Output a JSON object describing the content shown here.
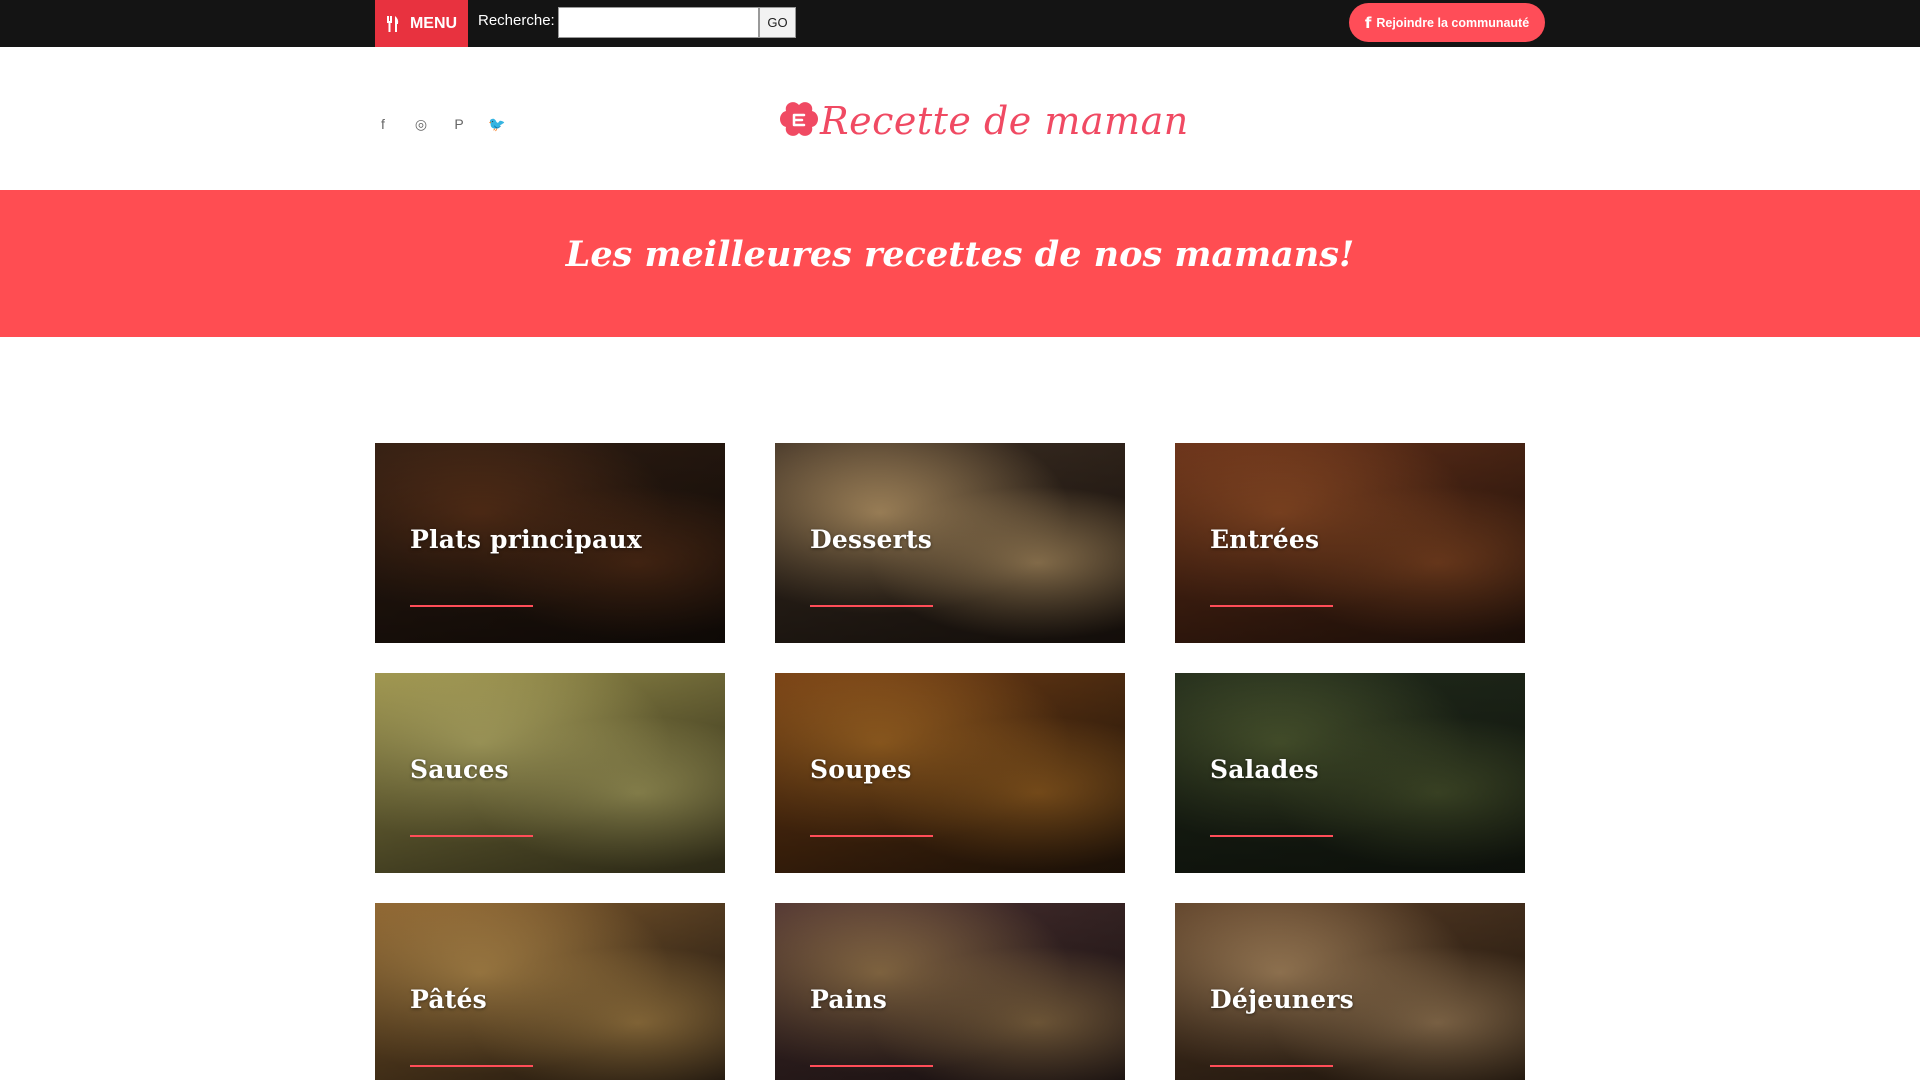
{
  "topbar": {
    "menu_label": "MENU",
    "search_label": "Recherche:",
    "search_value": "",
    "go_label": "GO",
    "community_label": "Rejoindre la communauté",
    "community_icon": "facebook-icon"
  },
  "header": {
    "socials": [
      {
        "icon": "facebook-icon",
        "glyph": "f"
      },
      {
        "icon": "instagram-icon",
        "glyph": "◎"
      },
      {
        "icon": "pinterest-icon",
        "glyph": "P"
      },
      {
        "icon": "twitter-icon",
        "glyph": "🐦"
      }
    ],
    "logo_text": "Recette de maman"
  },
  "banner": {
    "tagline": "Les meilleures recettes de nos mamans!"
  },
  "categories": [
    {
      "label": "Plats principaux",
      "colors": [
        "#3a2417",
        "#6b3a1d",
        "#1f140d"
      ]
    },
    {
      "label": "Desserts",
      "colors": [
        "#4a3a2c",
        "#d9b27a",
        "#2a1e16"
      ]
    },
    {
      "label": "Entrées",
      "colors": [
        "#7a3a1e",
        "#a95a2c",
        "#3b1f12"
      ]
    },
    {
      "label": "Sauces",
      "colors": [
        "#b8ad5a",
        "#d9cf7a",
        "#5e5830"
      ]
    },
    {
      "label": "Soupes",
      "colors": [
        "#8a4a18",
        "#c07a2a",
        "#3c2410"
      ]
    },
    {
      "label": "Salades",
      "colors": [
        "#27321f",
        "#5d6b3a",
        "#1c2418"
      ]
    },
    {
      "label": "Pâtés",
      "colors": [
        "#a47438",
        "#d5a55a",
        "#3a2a1c"
      ]
    },
    {
      "label": "Pains",
      "colors": [
        "#5a3a3a",
        "#b38c5a",
        "#2c1e1e"
      ]
    },
    {
      "label": "Déjeuners",
      "colors": [
        "#6b4a2f",
        "#c9a070",
        "#3a2818"
      ]
    }
  ],
  "colors": {
    "accent": "#ff4d58",
    "menu_red": "#e8323f",
    "banner": "#ff4d52",
    "logo": "#f04a63",
    "topbar": "#141414"
  }
}
